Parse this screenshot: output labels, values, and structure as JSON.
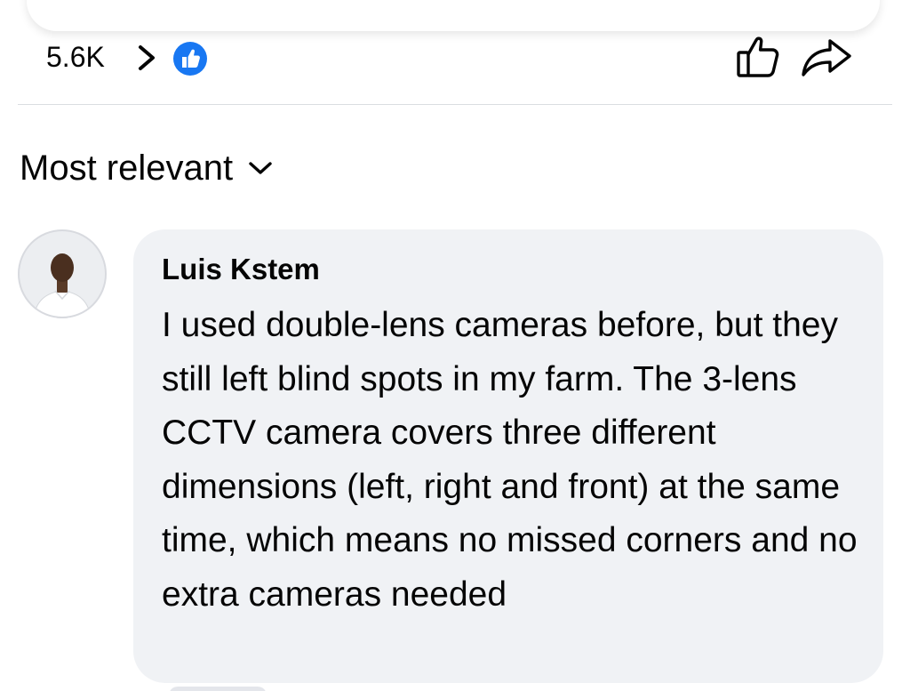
{
  "reactions": {
    "count": "5.6K",
    "reaction_type_icon": "like-badge-icon",
    "like_color": "#1877f2"
  },
  "actions": {
    "like_icon": "thumbs-up-outline-icon",
    "share_icon": "share-arrow-icon"
  },
  "sort": {
    "label": "Most relevant",
    "icon": "chevron-down-icon"
  },
  "comments": [
    {
      "author": "Luis Kstem",
      "text": "I used double-lens cameras before, but they still left blind spots in my farm. The 3-lens CCTV camera covers three different dimensions (left, right and front) at the same time, which means no missed corners and no extra cameras needed",
      "avatar_icon": "user-avatar"
    }
  ],
  "colors": {
    "bubble": "#f0f2f5",
    "divider": "#dadde1",
    "text": "#050505"
  }
}
